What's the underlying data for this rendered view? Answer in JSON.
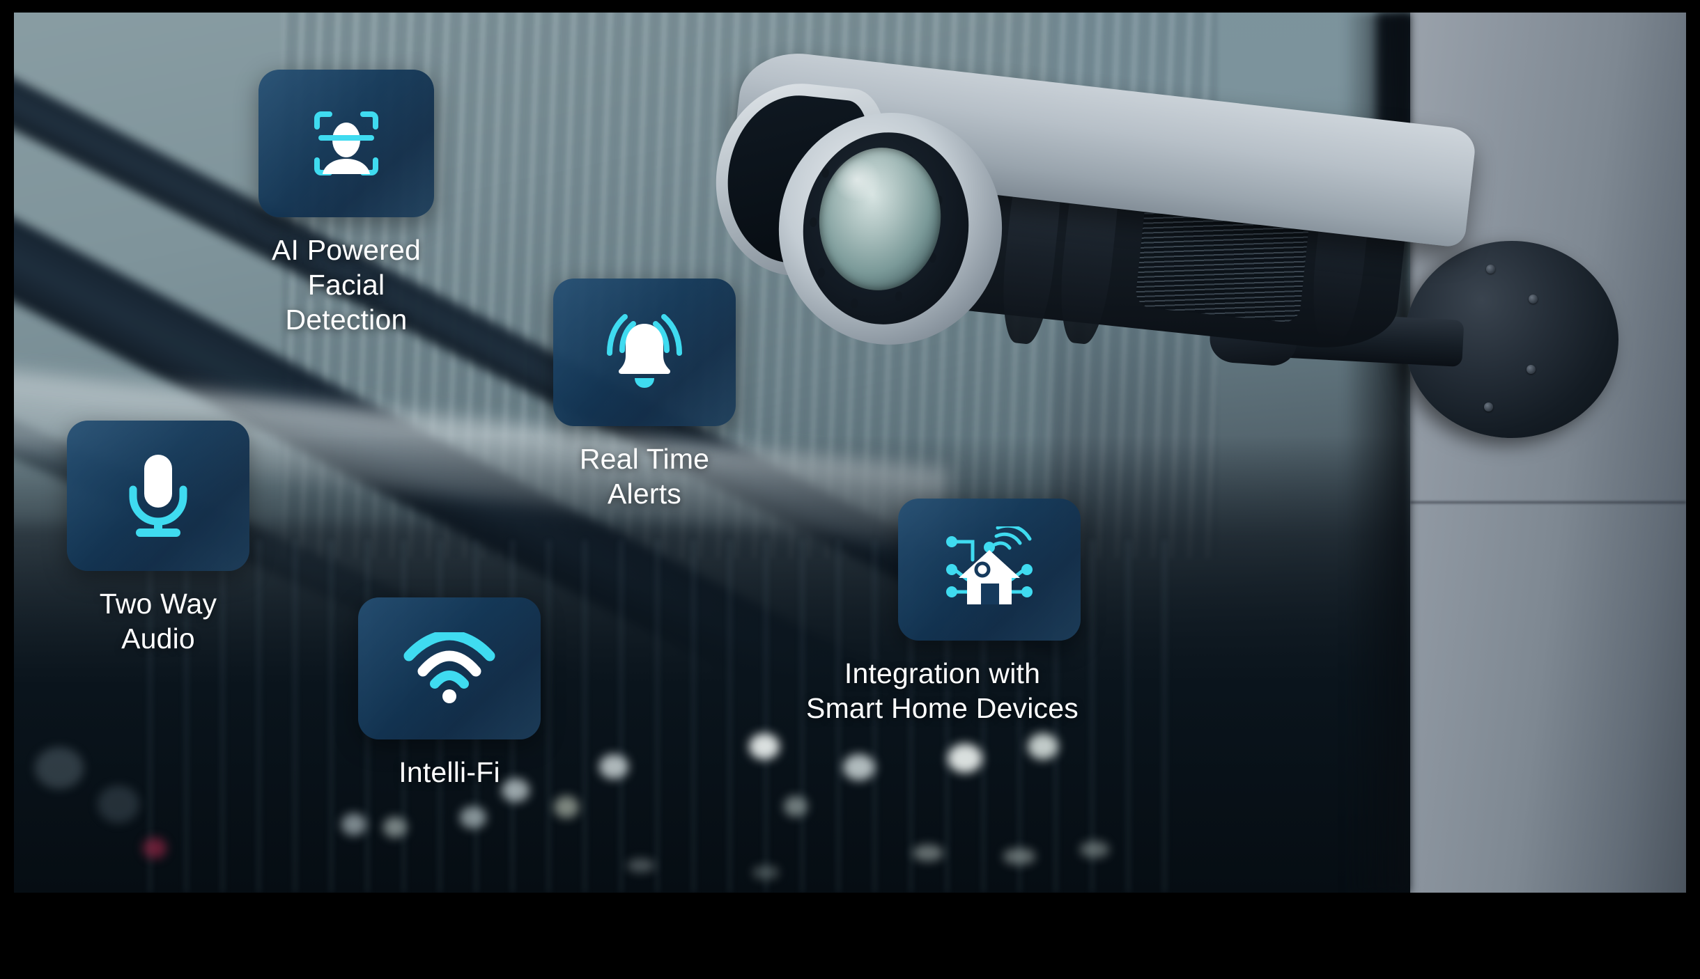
{
  "scene": {
    "subject": "wall-mounted outdoor CCTV security camera",
    "background": "blurred modern building facade at dusk with bokeh street lights"
  },
  "theme": {
    "tile_fill": "#14385 8",
    "tile_fill_hex": "#143858",
    "accent_cyan": "#3fdbf0",
    "icon_white": "#ffffff",
    "caption_color": "#ffffff",
    "letterbox": "#000000"
  },
  "features": [
    {
      "id": "ai-facial-detection",
      "icon": "face-scan-icon",
      "label": "AI Powered\nFacial Detection"
    },
    {
      "id": "real-time-alerts",
      "icon": "ringing-bell-icon",
      "label": "Real Time\nAlerts"
    },
    {
      "id": "two-way-audio",
      "icon": "microphone-icon",
      "label": "Two Way\nAudio"
    },
    {
      "id": "intelli-fi",
      "icon": "wifi-icon",
      "label": "Intelli-Fi"
    },
    {
      "id": "smart-home-integration",
      "icon": "smart-home-network-icon",
      "label": "Integration with\nSmart Home Devices"
    }
  ]
}
